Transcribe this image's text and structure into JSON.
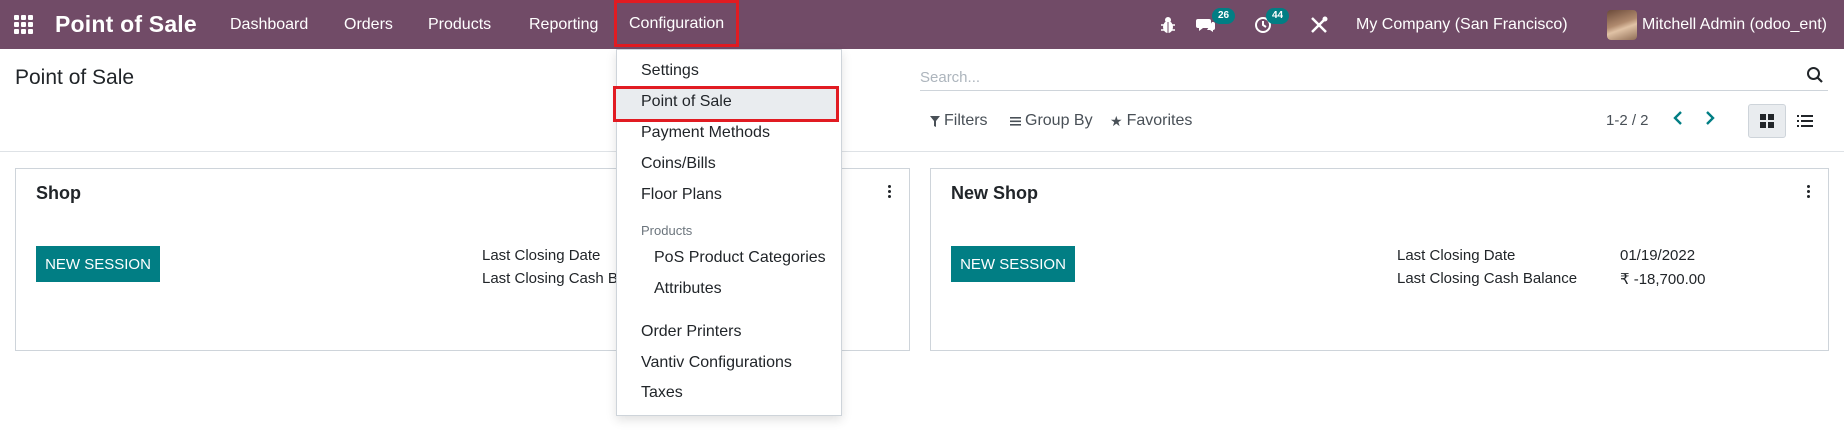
{
  "navbar": {
    "app_title": "Point of Sale",
    "menu": [
      "Dashboard",
      "Orders",
      "Products",
      "Reporting",
      "Configuration"
    ],
    "messages_count": "26",
    "activities_count": "44",
    "company": "My Company (San Francisco)",
    "user": "Mitchell Admin (odoo_ent)",
    "icons": [
      "apps-grid-icon",
      "bug-icon",
      "chat-icon",
      "clock-icon",
      "tools-icon"
    ],
    "colors": {
      "bar": "#714b67",
      "accent": "#017e84",
      "highlight": "#e11b22"
    }
  },
  "control_panel": {
    "title": "Point of Sale",
    "search_placeholder": "Search...",
    "filters_label": "Filters",
    "group_by_label": "Group By",
    "favorites_label": "Favorites",
    "pager": "1-2 / 2"
  },
  "cards": [
    {
      "name": "Shop",
      "button": "NEW SESSION",
      "last_closing_date_label": "Last Closing Date",
      "last_closing_cash_label": "Last Closing Cash Balance",
      "last_closing_cash_label_visible": "Last Closing Cash B"
    },
    {
      "name": "New Shop",
      "button": "NEW SESSION",
      "last_closing_date_label": "Last Closing Date",
      "last_closing_date": "01/19/2022",
      "last_closing_cash_label": "Last Closing Cash Balance",
      "last_closing_cash": "₹ -18,700.00"
    }
  ],
  "configuration_menu": {
    "items": [
      "Settings",
      "Point of Sale",
      "Payment Methods",
      "Coins/Bills",
      "Floor Plans"
    ],
    "products_header": "Products",
    "product_items": [
      "PoS Product Categories",
      "Attributes"
    ],
    "more_items": [
      "Order Printers",
      "Vantiv Configurations",
      "Taxes"
    ],
    "highlighted": "Point of Sale"
  }
}
